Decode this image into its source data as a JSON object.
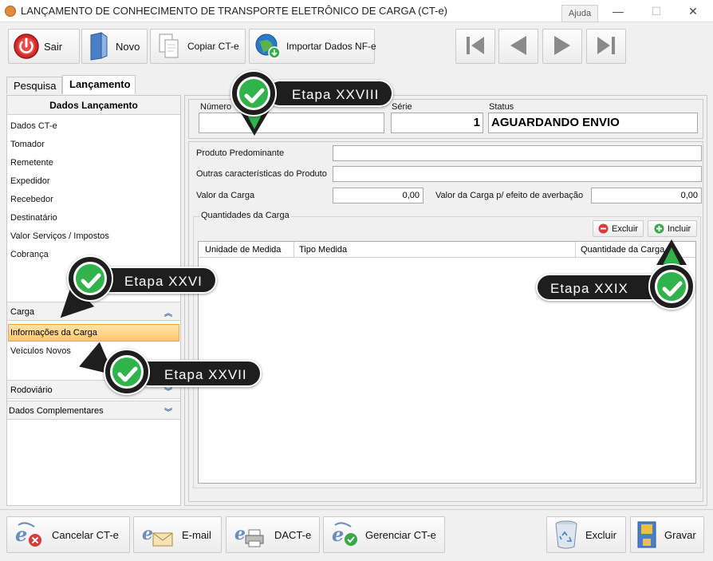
{
  "window": {
    "title": "LANÇAMENTO DE CONHECIMENTO DE TRANSPORTE ELETRÔNICO DE CARGA (CT-e)",
    "help": "Ajuda",
    "minimize": "—",
    "maximize": "☐",
    "close": "✕"
  },
  "toolbar": {
    "sair": "Sair",
    "novo": "Novo",
    "copiar": "Copiar CT-e",
    "importar": "Importar Dados NF-e"
  },
  "tabs": {
    "pesquisa": "Pesquisa",
    "lancamento": "Lançamento"
  },
  "sidebar": {
    "header": "Dados Lançamento",
    "items": [
      "Dados CT-e",
      "Tomador",
      "Remetente",
      "Expedidor",
      "Recebedor",
      "Destinatário",
      "Valor Serviços / Impostos",
      "Cobrança"
    ],
    "carga_header": "Carga",
    "carga_items": [
      "Informações da Carga",
      "Veículos Novos"
    ],
    "rodoviario": "Rodoviário",
    "dados_complementares": "Dados Complementares"
  },
  "header_fields": {
    "numero_label": "Número",
    "numero_value": "",
    "serie_label": "Série",
    "serie_value": "1",
    "status_label": "Status",
    "status_value": "AGUARDANDO ENVIO"
  },
  "carga_form": {
    "produto_label": "Produto Predominante",
    "produto_value": "",
    "outras_label": "Outras características do Produto",
    "outras_value": "",
    "valor_label": "Valor da Carga",
    "valor_value": "0,00",
    "valor_averb_label": "Valor da Carga p/ efeito de averbação",
    "valor_averb_value": "0,00"
  },
  "quantidades": {
    "title": "Quantidades da Carga",
    "excluir": "Excluir",
    "incluir": "Incluir",
    "columns": [
      "Unidade de Medida",
      "Tipo Medida",
      "Quantidade da Carga"
    ]
  },
  "footer": {
    "cancelar": "Cancelar CT-e",
    "email": "E-mail",
    "dacte": "DACT-e",
    "gerenciar": "Gerenciar CT-e",
    "excluir": "Excluir",
    "gravar": "Gravar"
  },
  "callouts": {
    "xxvi": "Etapa XXVI",
    "xxvii": "Etapa XXVII",
    "xxviii": "Etapa XXVIII",
    "xxix": "Etapa XXIX"
  },
  "colors": {
    "accent_green": "#2fb34a",
    "selected_item": "#ffc870",
    "callout_bg": "#1e1e1e"
  }
}
